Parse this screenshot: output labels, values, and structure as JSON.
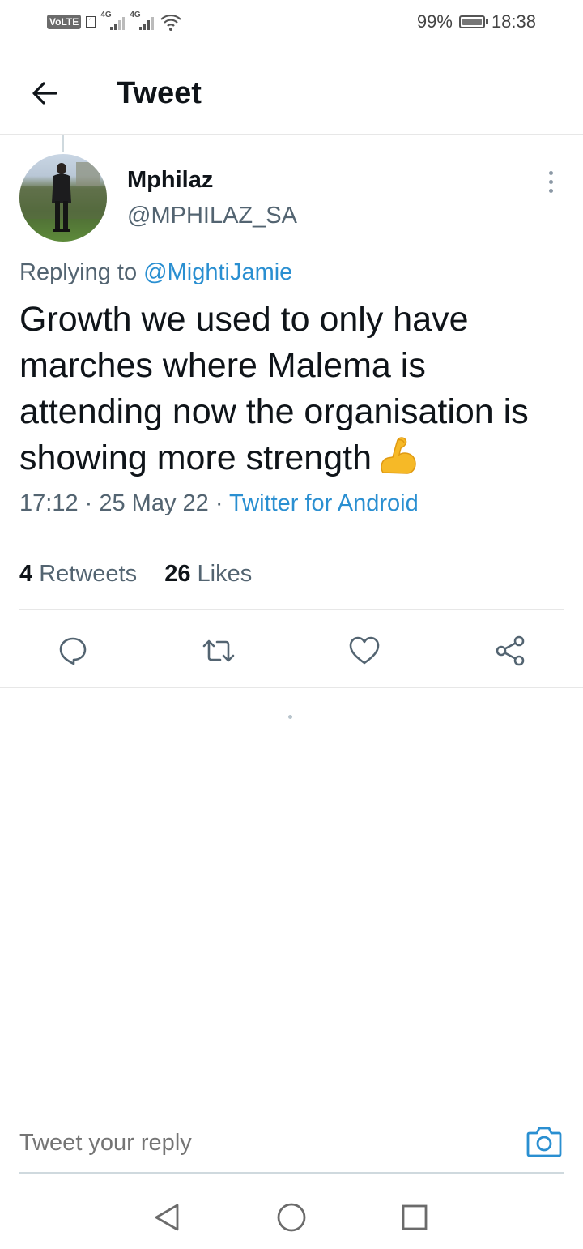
{
  "status_bar": {
    "volte": "VoLTE",
    "sim": "1",
    "network_1": "4G",
    "network_2": "4G",
    "battery_percent": "99%",
    "battery_level": 0.99,
    "time": "18:38",
    "icons": [
      "volte-icon",
      "signal-icon",
      "wifi-icon",
      "battery-icon"
    ]
  },
  "header": {
    "back_icon": "arrow-left-icon",
    "title": "Tweet"
  },
  "tweet": {
    "display_name": "Mphilaz",
    "handle": "@MPHILAZ_SA",
    "replying_prefix": "Replying to",
    "replying_to": "@MightiJamie",
    "text": "Growth we used to only have marches where Malema is attending now the organisation is showing more strength",
    "emoji": "flexed-biceps",
    "time": "17:12",
    "date": "25 May 22",
    "source": "Twitter for Android",
    "separator": " · ",
    "retweets_count": "4",
    "retweets_label": "Retweets",
    "likes_count": "26",
    "likes_label": "Likes"
  },
  "actions": [
    "reply-icon",
    "retweet-icon",
    "like-icon",
    "share-icon"
  ],
  "reply": {
    "placeholder": "Tweet your reply",
    "camera_icon": "camera-icon"
  },
  "nav": [
    "back-triangle-icon",
    "home-circle-icon",
    "recents-square-icon"
  ],
  "colors": {
    "link": "#2a8fd1",
    "text": "#0f1419",
    "secondary": "#536471",
    "divider": "#e7e7e7"
  }
}
